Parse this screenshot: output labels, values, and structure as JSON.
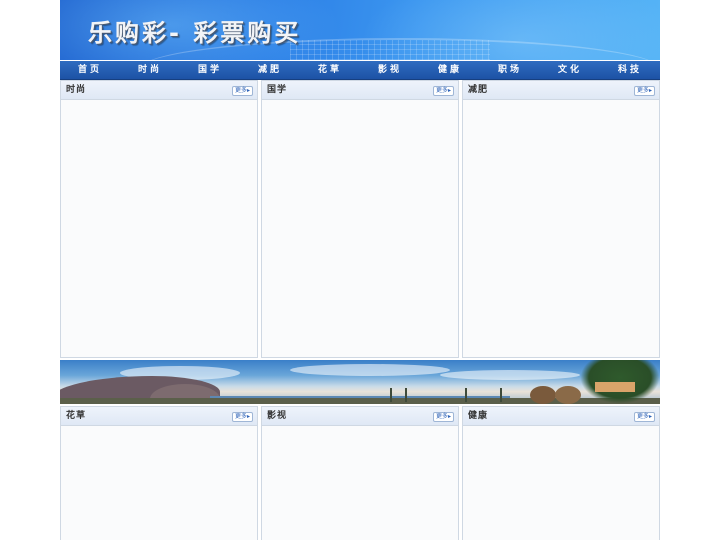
{
  "banner": {
    "title": "乐购彩- 彩票购买"
  },
  "nav": {
    "items": [
      "首页",
      "时尚",
      "国学",
      "减肥",
      "花草",
      "影视",
      "健康",
      "职场",
      "文化",
      "科技"
    ]
  },
  "more_label": "更多",
  "panels_row1": [
    {
      "title": "时尚"
    },
    {
      "title": "国学"
    },
    {
      "title": "减肥"
    }
  ],
  "panels_row2": [
    {
      "title": "花草"
    },
    {
      "title": "影视"
    },
    {
      "title": "健康"
    }
  ],
  "colors": {
    "banner_blue": "#2c7fe6",
    "nav_blue": "#1d52a5",
    "panel_header": "#e5edf8",
    "panel_border": "#cfd8e3"
  }
}
